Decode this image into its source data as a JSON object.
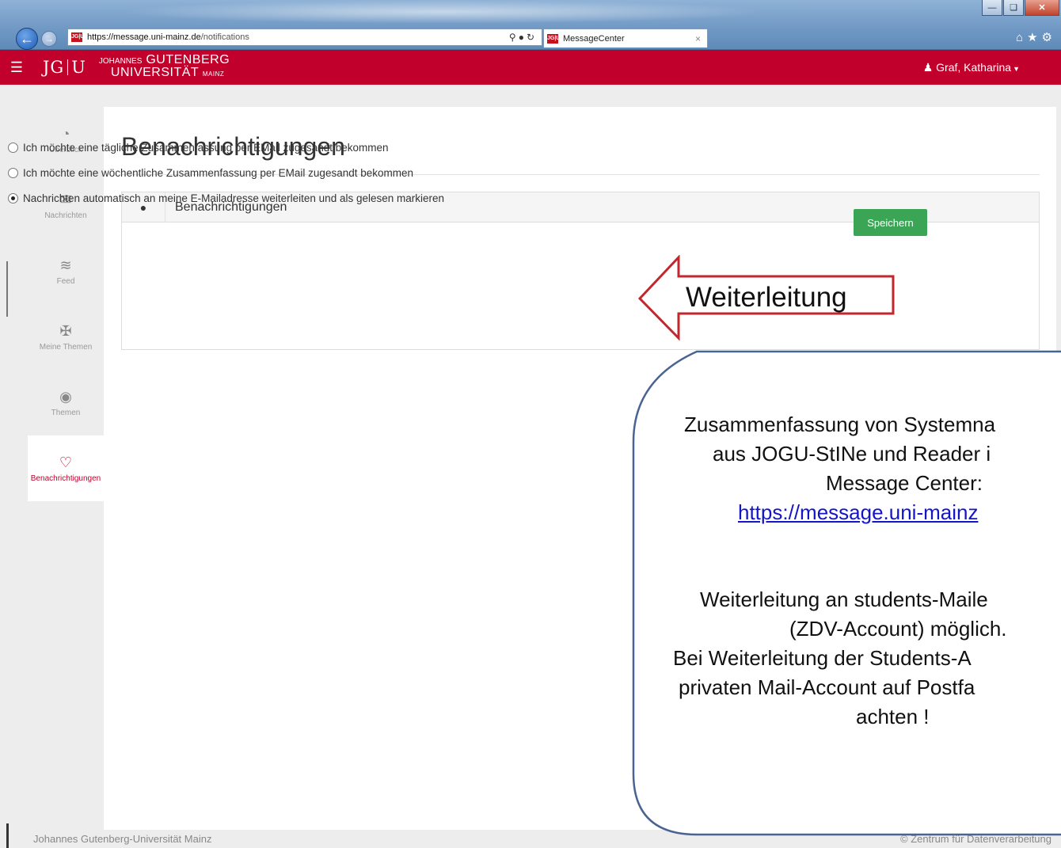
{
  "browser": {
    "address_scheme": "https://",
    "address_host": "message.uni-mainz.de",
    "address_path": "/notifications",
    "tab_title": "MessageCenter",
    "favicon_text": "JG|U"
  },
  "app": {
    "logo_mark_left": "JG",
    "logo_mark_right": "U",
    "logo_line1_small": "JOHANNES",
    "logo_line1": "GUTENBERG",
    "logo_line2": "UNIVERSITÄT",
    "logo_line2_small": "MAINZ",
    "user_name": "Graf, Katharina",
    "brand_color": "#c1002b"
  },
  "sidebar": {
    "items": [
      {
        "label": "Überblick",
        "icon": "dashboard-icon"
      },
      {
        "label": "Nachrichten",
        "icon": "envelope-icon"
      },
      {
        "label": "Feed",
        "icon": "rss-icon"
      },
      {
        "label": "Meine Themen",
        "icon": "pin-icon"
      },
      {
        "label": "Themen",
        "icon": "globe-icon"
      },
      {
        "label": "Benachrichtigungen",
        "icon": "bell-icon",
        "active": true
      }
    ]
  },
  "main": {
    "title": "Benachrichtigungen",
    "panel_title": "Benachrichtigungen",
    "options": [
      {
        "label": "Ich möchte eine tägliche Zusammenfassung per EMail zugesandt bekommen",
        "selected": false
      },
      {
        "label": "Ich möchte eine wöchentliche Zusammenfassung per EMail zugesandt bekommen",
        "selected": false
      },
      {
        "label": "Nachrichten automatisch an meine E-Mailadresse weiterleiten und als gelesen markieren",
        "selected": true
      }
    ],
    "save_label": "Speichern"
  },
  "annotation": {
    "arrow_label": "Weiterleitung",
    "callout_line1": "Zusammenfassung von Systemna",
    "callout_line2": "aus JOGU-StINe und Reader i",
    "callout_line3": "Message Center:",
    "callout_link": "https://message.uni-mainz",
    "callout_line5": "Weiterleitung an students-Maile",
    "callout_line6": "(ZDV-Account) möglich.",
    "callout_line7": "Bei Weiterleitung der Students-A",
    "callout_line8": "privaten Mail-Account auf Postfa",
    "callout_line9": "achten !"
  },
  "footer": {
    "left": "Johannes Gutenberg-Universität Mainz",
    "right": "© Zentrum für Datenverarbeitung"
  }
}
